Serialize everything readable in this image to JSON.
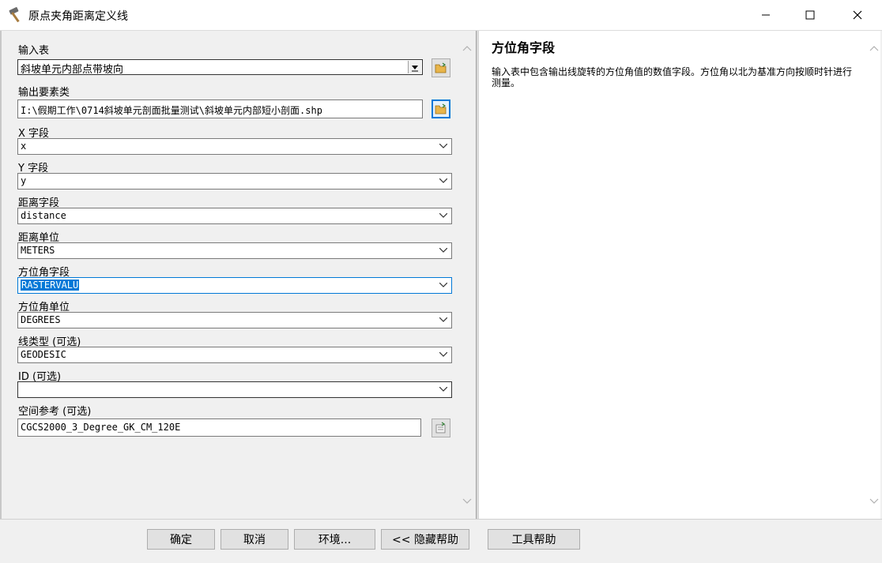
{
  "window": {
    "title": "原点夹角距离定义线",
    "app_icon": "hammer-icon",
    "controls": [
      "minimize-icon",
      "maximize-icon",
      "close-icon"
    ]
  },
  "form": {
    "input_table": {
      "label": "输入表",
      "value": "斜坡单元内部点带坡向"
    },
    "output_feature_class": {
      "label": "输出要素类",
      "value": "I:\\假期工作\\0714斜坡单元剖面批量测试\\斜坡单元内部短小剖面.shp"
    },
    "x_field": {
      "label": "X 字段",
      "value": "x"
    },
    "y_field": {
      "label": "Y 字段",
      "value": "y"
    },
    "distance_field": {
      "label": "距离字段",
      "value": "distance"
    },
    "distance_units": {
      "label": "距离单位",
      "value": "METERS"
    },
    "bearing_field": {
      "label": "方位角字段",
      "value": "RASTERVALU"
    },
    "bearing_units": {
      "label": "方位角单位",
      "value": "DEGREES"
    },
    "line_type": {
      "label": "线类型 (可选)",
      "value": "GEODESIC"
    },
    "id_field": {
      "label": "ID (可选)",
      "value": ""
    },
    "spatial_reference": {
      "label": "空间参考 (可选)",
      "value": "CGCS2000_3_Degree_GK_CM_120E"
    }
  },
  "help": {
    "title": "方位角字段",
    "text": "输入表中包含输出线旋转的方位角值的数值字段。方位角以北为基准方向按顺时针进行测量。"
  },
  "buttons": {
    "ok": "确定",
    "cancel": "取消",
    "environments": "环境...",
    "hide_help": "<< 隐藏帮助",
    "tool_help": "工具帮助"
  },
  "colors": {
    "accent": "#0078d7",
    "background": "#f0f0f0"
  }
}
